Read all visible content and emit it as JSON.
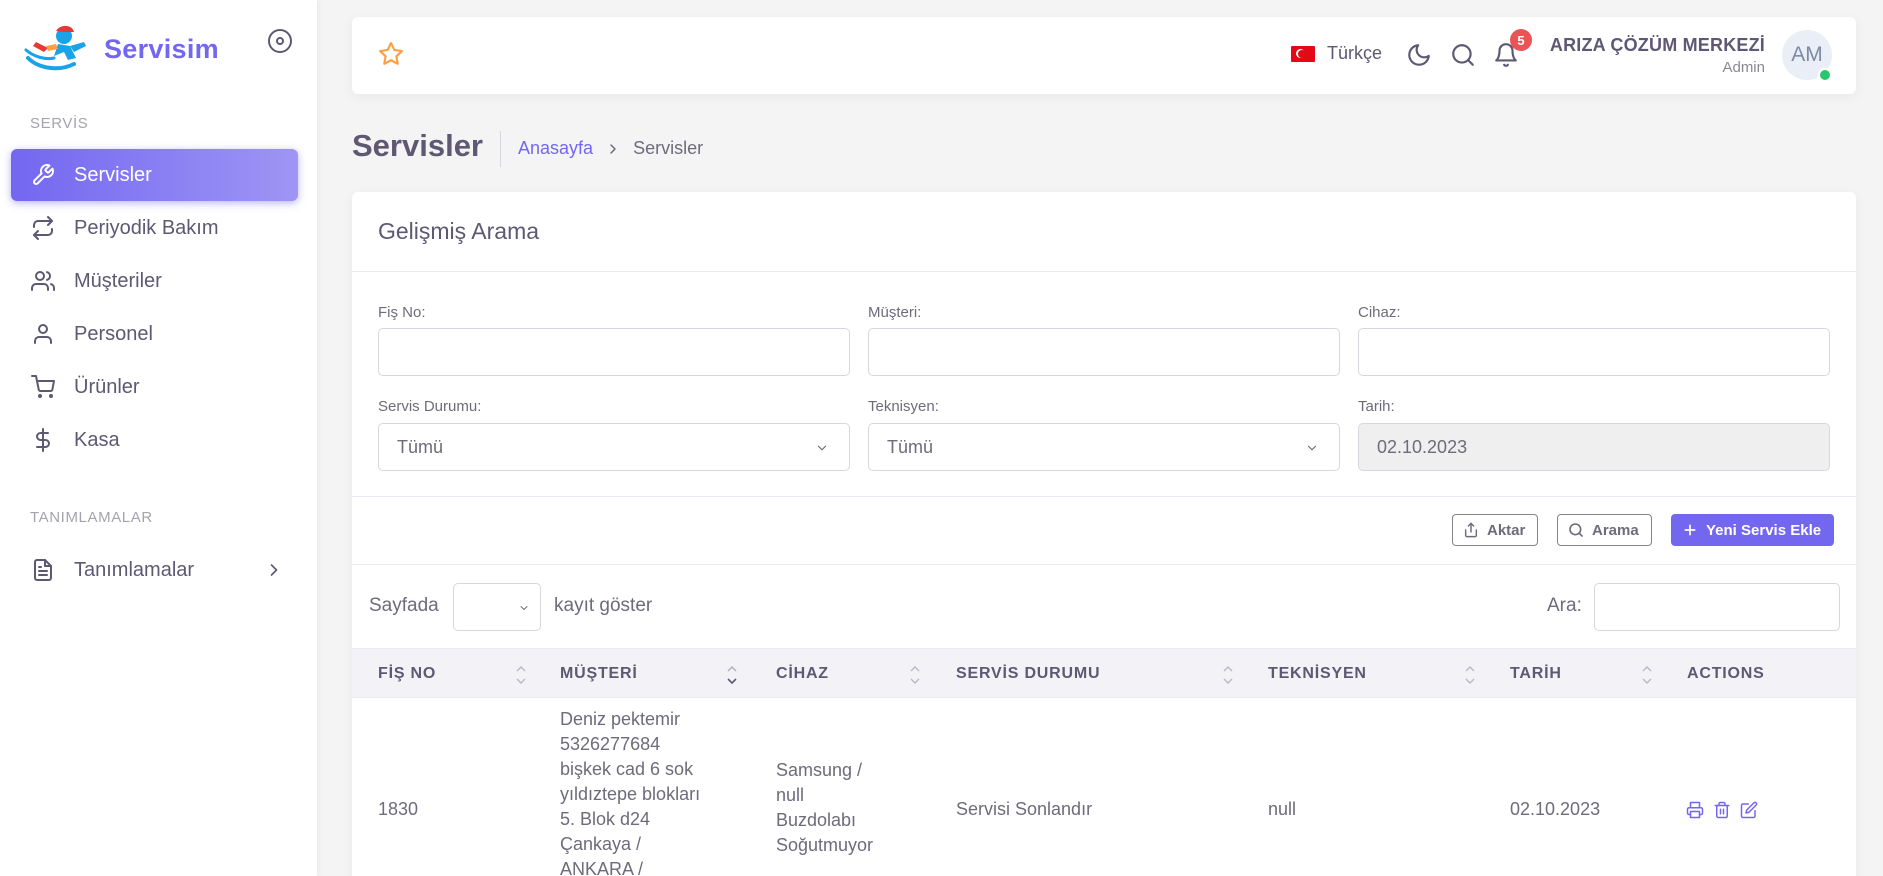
{
  "brand": {
    "name": "Servisim"
  },
  "sidebar": {
    "section1": "SERVİS",
    "items": [
      {
        "label": "Servisler",
        "icon": "wrench-icon",
        "active": true
      },
      {
        "label": "Periyodik Bakım",
        "icon": "repeat-icon"
      },
      {
        "label": "Müşteriler",
        "icon": "users-icon"
      },
      {
        "label": "Personel",
        "icon": "user-icon"
      },
      {
        "label": "Ürünler",
        "icon": "cart-icon"
      },
      {
        "label": "Kasa",
        "icon": "dollar-icon"
      }
    ],
    "section2": "TANIMLAMALAR",
    "definitions": {
      "label": "Tanımlamalar",
      "icon": "file-text-icon"
    }
  },
  "header": {
    "language": "Türkçe",
    "notifications_count": "5",
    "user_name": "ARIZA ÇÖZÜM MERKEZİ",
    "user_role": "Admin",
    "avatar_initials": "AM",
    "colors": {
      "accent": "#7367f0",
      "badge": "#ea5455",
      "online": "#28c76f",
      "star": "#ff9f43"
    }
  },
  "page": {
    "title": "Servisler",
    "breadcrumb_home": "Anasayfa",
    "breadcrumb_current": "Servisler"
  },
  "search": {
    "title": "Gelişmiş Arama",
    "fis_no_label": "Fiş No:",
    "musteri_label": "Müşteri:",
    "cihaz_label": "Cihaz:",
    "durum_label": "Servis Durumu:",
    "durum_value": "Tümü",
    "teknisyen_label": "Teknisyen:",
    "teknisyen_value": "Tümü",
    "tarih_label": "Tarih:",
    "tarih_value": "02.10.2023"
  },
  "actions": {
    "export": "Aktar",
    "search": "Arama",
    "add": "Yeni Servis Ekle"
  },
  "table": {
    "length_prefix": "Sayfada",
    "length_suffix": "kayıt göster",
    "search_label": "Ara:",
    "columns": [
      "FİŞ NO",
      "MÜŞTERİ",
      "CİHAZ",
      "SERVİS DURUMU",
      "TEKNİSYEN",
      "TARİH",
      "ACTIONS"
    ],
    "rows": [
      {
        "fis_no": "1830",
        "musteri": [
          "Deniz pektemir",
          "5326277684",
          "bişkek cad 6 sok",
          "yıldıztepe blokları",
          "5. Blok d24",
          "Çankaya /",
          "ANKARA /"
        ],
        "cihaz": [
          "Samsung /",
          "null",
          "Buzdolabı",
          "Soğutmuyor"
        ],
        "durum": "Servisi Sonlandır",
        "teknisyen": "null",
        "tarih": "02.10.2023"
      }
    ]
  }
}
